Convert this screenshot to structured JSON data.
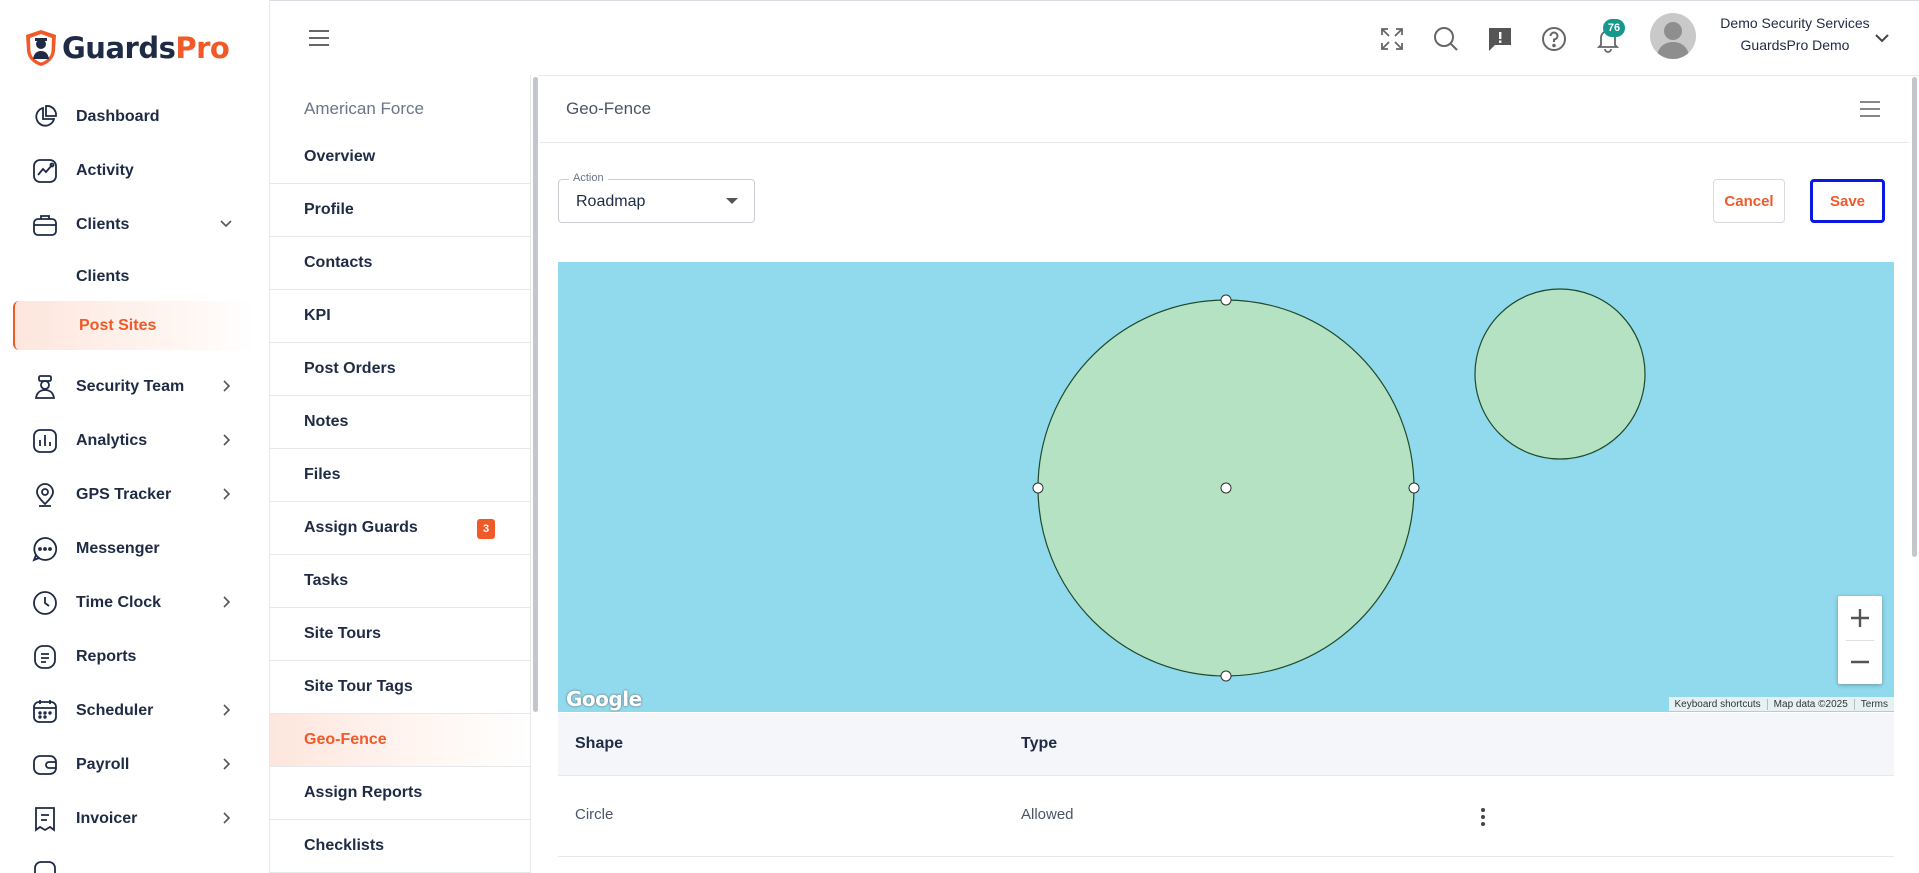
{
  "app": {
    "brand_main": "Guards",
    "brand_accent": "Pro"
  },
  "colors": {
    "accent": "#f05a28",
    "map_water": "#91d9ec",
    "fence_fill": "#b5e2c3",
    "badge_teal": "#14998c",
    "save_highlight": "#0a18e0"
  },
  "sidebar": {
    "items": [
      {
        "label": "Dashboard",
        "icon": "dashboard-icon"
      },
      {
        "label": "Activity",
        "icon": "activity-icon"
      },
      {
        "label": "Clients",
        "icon": "briefcase-icon",
        "expanded": true
      },
      {
        "label": "Clients",
        "sub": true
      },
      {
        "label": "Post Sites",
        "sub": true,
        "active": true
      },
      {
        "label": "Security Team",
        "icon": "guard-icon"
      },
      {
        "label": "Analytics",
        "icon": "analytics-icon"
      },
      {
        "label": "GPS Tracker",
        "icon": "location-icon"
      },
      {
        "label": "Messenger",
        "icon": "chat-icon"
      },
      {
        "label": "Time Clock",
        "icon": "clock-icon"
      },
      {
        "label": "Reports",
        "icon": "reports-icon"
      },
      {
        "label": "Scheduler",
        "icon": "calendar-icon"
      },
      {
        "label": "Payroll",
        "icon": "wallet-icon"
      },
      {
        "label": "Invoicer",
        "icon": "invoice-icon"
      }
    ]
  },
  "header": {
    "notifications_count": "76",
    "user_name": "Demo Security Services",
    "user_company": "GuardsPro Demo"
  },
  "subnav": {
    "title": "American Force",
    "items": [
      {
        "label": "Overview"
      },
      {
        "label": "Profile"
      },
      {
        "label": "Contacts"
      },
      {
        "label": "KPI"
      },
      {
        "label": "Post Orders"
      },
      {
        "label": "Notes"
      },
      {
        "label": "Files"
      },
      {
        "label": "Assign Guards",
        "badge": "3"
      },
      {
        "label": "Tasks"
      },
      {
        "label": "Site Tours"
      },
      {
        "label": "Site Tour Tags"
      },
      {
        "label": "Geo-Fence",
        "active": true
      },
      {
        "label": "Assign Reports"
      },
      {
        "label": "Checklists"
      }
    ]
  },
  "main": {
    "title": "Geo-Fence",
    "action_label": "Action",
    "action_value": "Roadmap",
    "cancel_label": "Cancel",
    "save_label": "Save",
    "map": {
      "logo_text": "Google",
      "attribution": [
        "Keyboard shortcuts",
        "Map data ©2025",
        "Terms"
      ]
    },
    "table": {
      "headers": [
        "Shape",
        "Type"
      ],
      "rows": [
        {
          "shape": "Circle",
          "type": "Allowed"
        }
      ]
    }
  }
}
